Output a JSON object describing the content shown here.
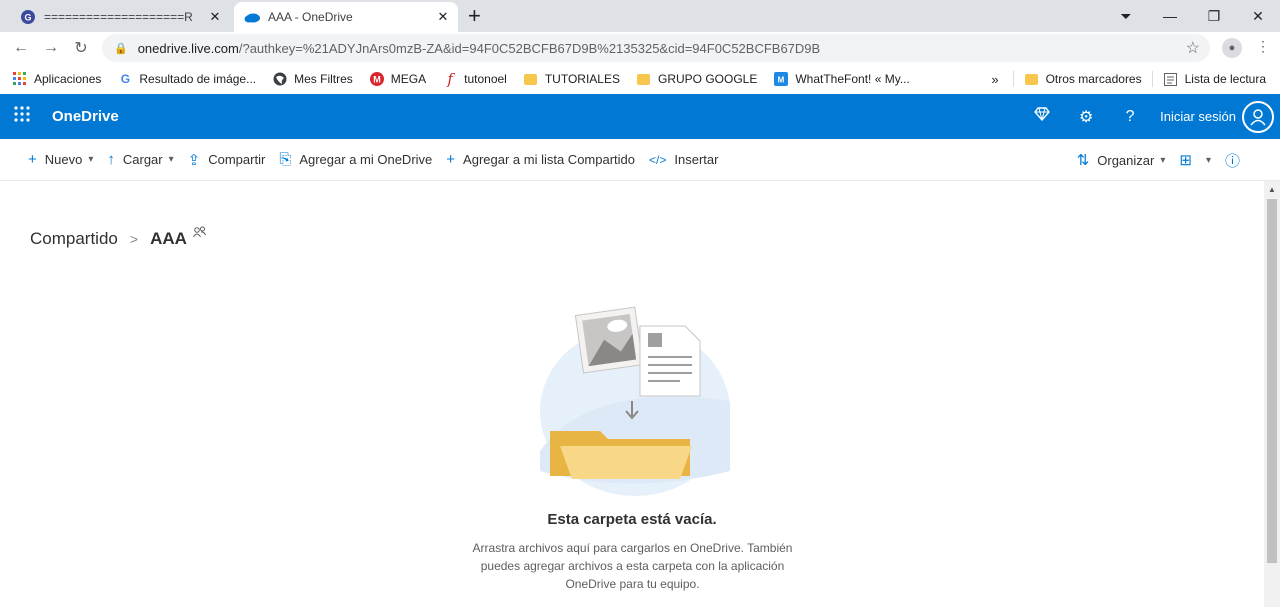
{
  "browser": {
    "tabs": [
      {
        "title": "====================R",
        "active": false,
        "favicon": "g-circle-icon"
      },
      {
        "title": "AAA - OneDrive",
        "active": true,
        "favicon": "onedrive-cloud-icon"
      }
    ],
    "url_host": "onedrive.live.com",
    "url_rest": "/?authkey=%21ADYJnArs0mzB-ZA&id=94F0C52BCFB67D9B%2135325&cid=94F0C52BCFB67D9B",
    "bookmarks": [
      {
        "label": "Aplicaciones",
        "icon": "apps-grid-icon"
      },
      {
        "label": "Resultado de imáge...",
        "icon": "google-icon"
      },
      {
        "label": "Mes Filtres",
        "icon": "globe-icon"
      },
      {
        "label": "MEGA",
        "icon": "mega-icon"
      },
      {
        "label": "tutonoel",
        "icon": "f-script-icon"
      },
      {
        "label": "TUTORIALES",
        "icon": "folder-icon"
      },
      {
        "label": "GRUPO GOOGLE",
        "icon": "folder-icon"
      },
      {
        "label": "WhatTheFont! « My...",
        "icon": "wtf-icon"
      }
    ],
    "bookmarks_overflow": "»",
    "other_bookmarks": "Otros marcadores",
    "reading_list": "Lista de lectura"
  },
  "onedrive": {
    "brand": "OneDrive",
    "signin": "Iniciar sesión",
    "commands": [
      {
        "label": "Nuevo",
        "icon": "+",
        "dropdown": true
      },
      {
        "label": "Cargar",
        "icon": "↑",
        "dropdown": true
      },
      {
        "label": "Compartir",
        "icon": "⇪",
        "dropdown": false
      },
      {
        "label": "Agregar a mi OneDrive",
        "icon": "⎘",
        "dropdown": false
      },
      {
        "label": "Agregar a mi lista Compartido",
        "icon": "+",
        "dropdown": false
      },
      {
        "label": "Insertar",
        "icon": "</>",
        "dropdown": false
      }
    ],
    "organize": "Organizar",
    "breadcrumb": {
      "parent": "Compartido",
      "current": "AAA"
    },
    "empty_title": "Esta carpeta está vacía.",
    "empty_desc": "Arrastra archivos aquí para cargarlos en OneDrive. También puedes agregar archivos a esta carpeta con la aplicación OneDrive para tu equipo."
  },
  "colors": {
    "brand_blue": "#0078d4",
    "folder": "#f6c64d"
  }
}
